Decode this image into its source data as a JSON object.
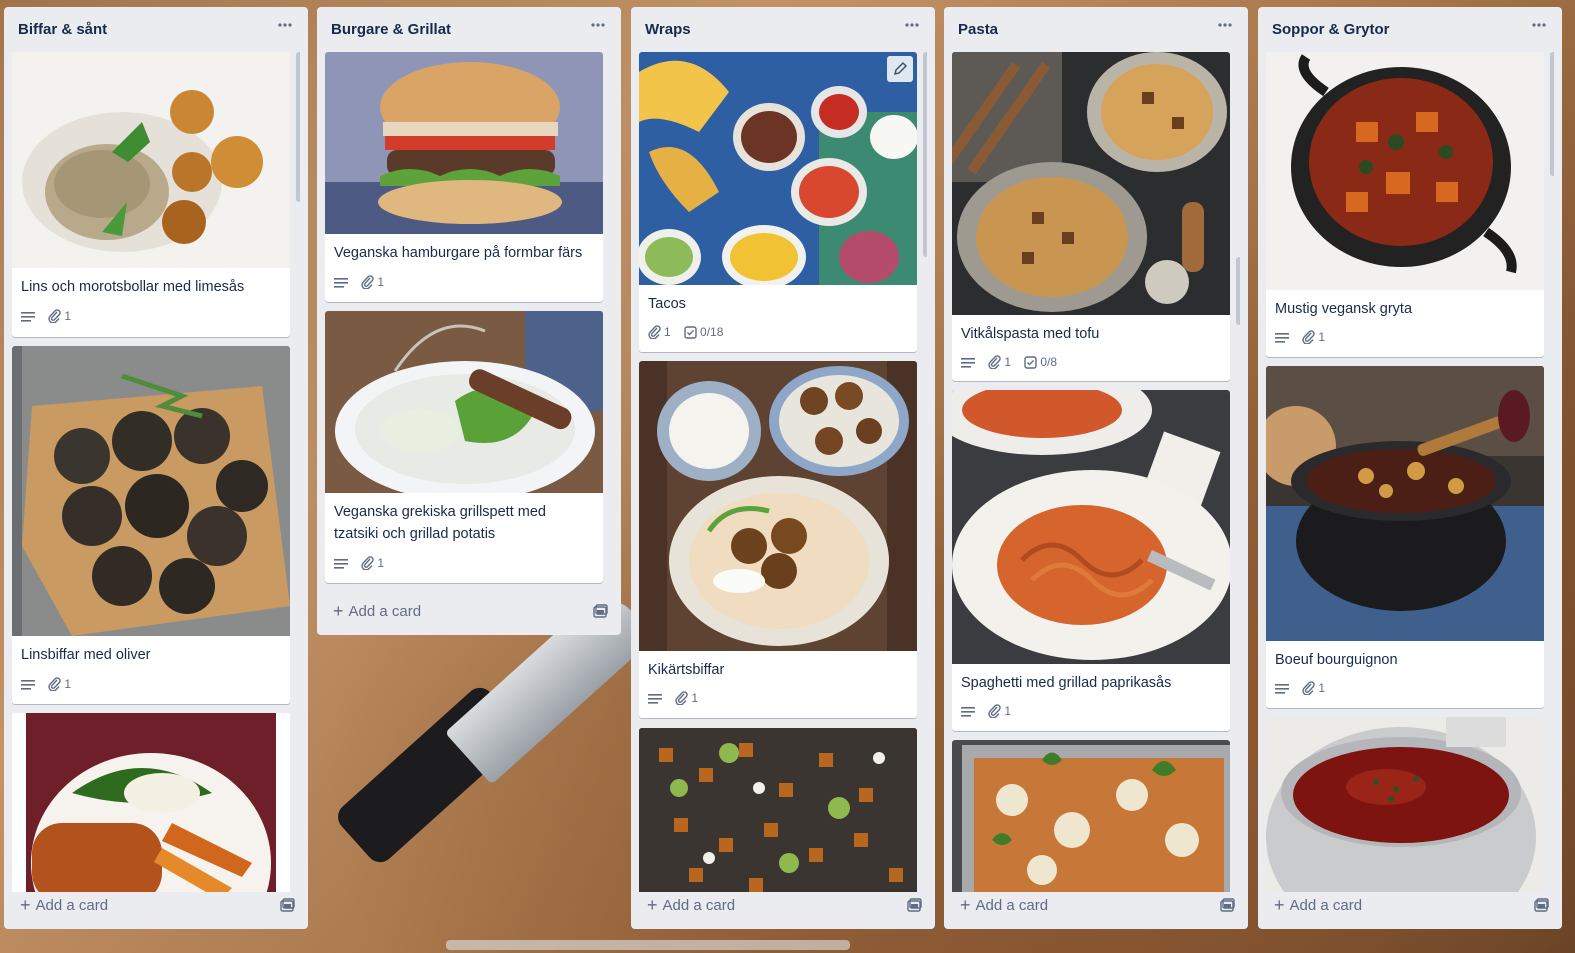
{
  "colors": {
    "list_bg": "#ebecf0",
    "card_bg": "#ffffff",
    "text_primary": "#172b4d",
    "text_secondary": "#5e6c84",
    "background": "#a8774b"
  },
  "lists": [
    {
      "title": "Biffar & sånt",
      "menu_icon": "more-horizontal-icon",
      "add_label": "Add a card",
      "cards": [
        {
          "title": "Lins och morotsbollar med limesås",
          "attachments": "1",
          "cover": "lentil-carrot-balls-photo"
        },
        {
          "title": "Linsbiffar med oliver",
          "attachments": "1",
          "cover": "lentil-patties-photo"
        },
        {
          "cover": "crispy-cutlet-salad-photo"
        }
      ]
    },
    {
      "title": "Burgare & Grillat",
      "menu_icon": "more-horizontal-icon",
      "add_label": "Add a card",
      "cards": [
        {
          "title": "Veganska hamburgare på formbar färs",
          "attachments": "1",
          "cover": "vegan-burger-photo"
        },
        {
          "title": "Veganska grekiska grillspett med tzatsiki och grillad potatis",
          "attachments": "1",
          "cover": "greek-skewers-photo"
        }
      ]
    },
    {
      "title": "Wraps",
      "menu_icon": "more-horizontal-icon",
      "add_label": "Add a card",
      "cards": [
        {
          "title": "Tacos",
          "attachments": "1",
          "checklist": "0/18",
          "cover": "taco-spread-photo"
        },
        {
          "title": "Kikärtsbiffar",
          "attachments": "1",
          "cover": "falafel-wrap-photo"
        },
        {
          "cover": "roasted-sweet-potato-tray-photo"
        }
      ]
    },
    {
      "title": "Pasta",
      "menu_icon": "more-horizontal-icon",
      "add_label": "Add a card",
      "cards": [
        {
          "title": "Vitkålspasta med tofu",
          "attachments": "1",
          "checklist": "0/8",
          "cover": "cabbage-pasta-photo"
        },
        {
          "title": "Spaghetti med grillad paprikasås",
          "attachments": "1",
          "cover": "spaghetti-pepper-sauce-photo"
        },
        {
          "cover": "baked-pasta-gratin-photo"
        }
      ]
    },
    {
      "title": "Soppor & Grytor",
      "menu_icon": "more-horizontal-icon",
      "add_label": "Add a card",
      "cards": [
        {
          "title": "Mustig vegansk gryta",
          "attachments": "1",
          "cover": "vegan-stew-pot-photo"
        },
        {
          "title": "Boeuf bourguignon",
          "attachments": "1",
          "cover": "bourguignon-pot-photo"
        },
        {
          "cover": "tomato-soup-pot-photo"
        }
      ]
    }
  ]
}
